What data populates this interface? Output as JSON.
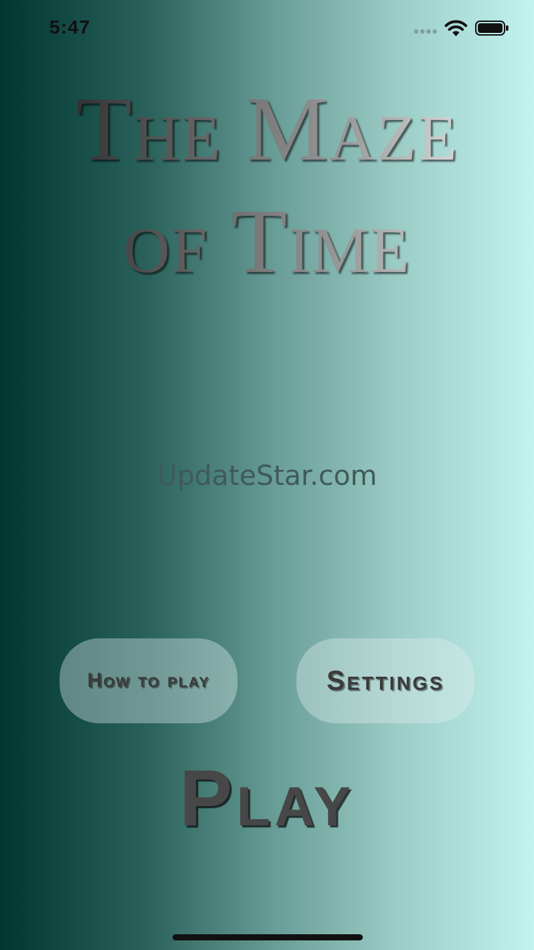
{
  "status_bar": {
    "time": "5:47",
    "icons": [
      "cellular-signal-icon",
      "wifi-icon",
      "battery-icon"
    ]
  },
  "title": {
    "line1": "The Maze",
    "line2": "of Time"
  },
  "watermark": "UpdateStar.com",
  "buttons": {
    "how_to_play": "How to play",
    "settings": "Settings",
    "play": "Play"
  },
  "colors": {
    "background_left": "#003630",
    "background_right": "#c3f3ee",
    "button_fill": "rgba(225,240,238,0.38)",
    "text_dark": "#3a3a3a"
  }
}
